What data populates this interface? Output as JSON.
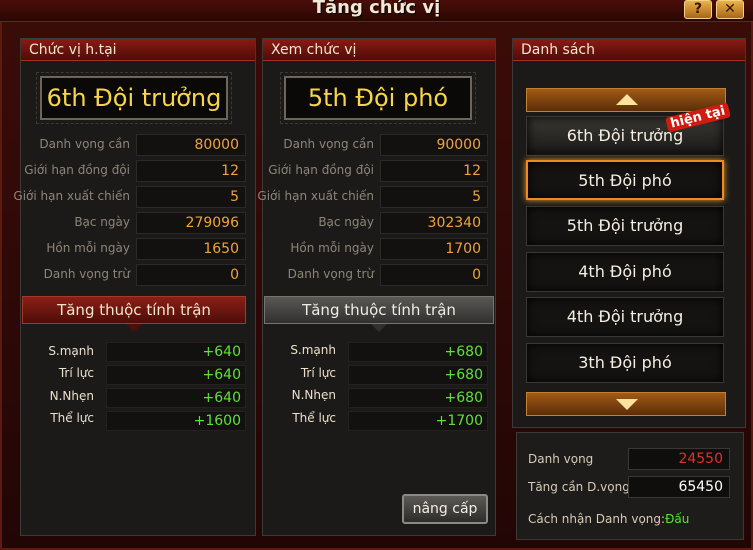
{
  "window": {
    "title": "Tăng chức vị",
    "help_label": "?",
    "close_label": "✕"
  },
  "current": {
    "header": "Chức vị h.tại",
    "rank": "6th Đội trưởng",
    "stats": [
      {
        "label": "Danh vọng cần",
        "value": "80000"
      },
      {
        "label": "Giới hạn đồng đội",
        "value": "12"
      },
      {
        "label": "Giới hạn xuất chiến",
        "value": "5"
      },
      {
        "label": "Bạc ngày",
        "value": "279096"
      },
      {
        "label": "Hồn mỗi ngày",
        "value": "1650"
      },
      {
        "label": "Danh vọng trừ",
        "value": "0"
      }
    ],
    "attr_header": "Tăng thuộc tính trận",
    "attrs": [
      {
        "label": "S.mạnh",
        "value": "+640"
      },
      {
        "label": "Trí lực",
        "value": "+640"
      },
      {
        "label": "N.Nhẹn",
        "value": "+640"
      },
      {
        "label": "Thể lực",
        "value": "+1600"
      }
    ]
  },
  "preview": {
    "header": "Xem chức vị",
    "rank": "5th  Đội phó",
    "stats": [
      {
        "label": "Danh vọng cần",
        "value": "90000"
      },
      {
        "label": "Giới hạn đồng đội",
        "value": "12"
      },
      {
        "label": "Giới hạn xuất chiến",
        "value": "5"
      },
      {
        "label": "Bạc ngày",
        "value": "302340"
      },
      {
        "label": "Hồn mỗi ngày",
        "value": "1700"
      },
      {
        "label": "Danh vọng trừ",
        "value": "0"
      }
    ],
    "attr_header": "Tăng thuộc tính trận",
    "attrs": [
      {
        "label": "S.mạnh",
        "value": "+680"
      },
      {
        "label": "Trí lực",
        "value": "+680"
      },
      {
        "label": "N.Nhẹn",
        "value": "+680"
      },
      {
        "label": "Thể lực",
        "value": "+1700"
      }
    ],
    "upgrade_label": "nâng cấp"
  },
  "list": {
    "header": "Danh sách",
    "current_badge": "hiện tại",
    "items": [
      "6th Đội trưởng",
      "5th  Đội phó",
      "5th  Đội trưởng",
      "4th  Đội phó",
      "4th  Đội trưởng",
      "3th  Đội phó"
    ],
    "selected_index": 1
  },
  "info": {
    "fame_label": "Danh vọng",
    "fame_value": "24550",
    "need_label": "Tăng cần D.vọng",
    "need_value": "65450",
    "method_label": "Cách nhận Danh vọng:",
    "method_link": "Đấu"
  },
  "colors": {
    "fame_value": "#e0302a",
    "need_value": "#ffffff",
    "method_link": "#5fe03a",
    "stat_value": "#f0a33a",
    "attr_value": "#5fe03a",
    "rank_text": "#f7d54a"
  }
}
